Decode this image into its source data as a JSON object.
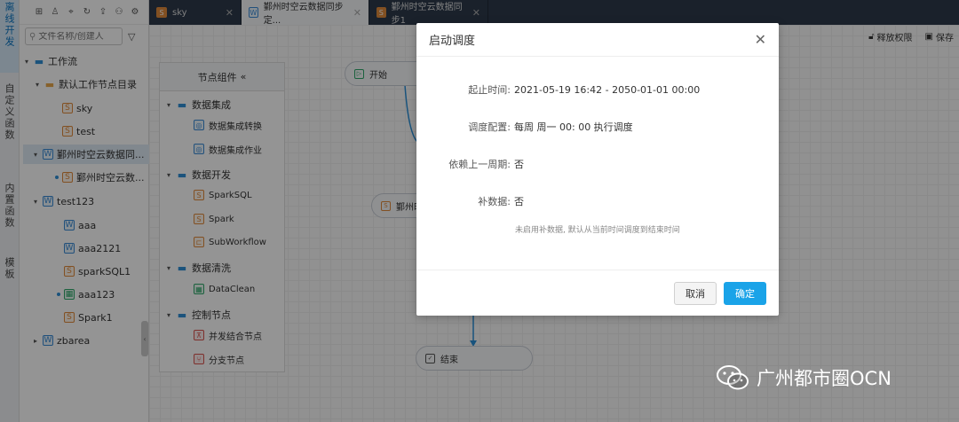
{
  "left_nav": {
    "items": [
      {
        "label": "离线开发",
        "active": true
      },
      {
        "label": "自定义函数",
        "active": false
      },
      {
        "label": "内置函数",
        "active": false
      },
      {
        "label": "模板",
        "active": false
      }
    ]
  },
  "tree": {
    "search_placeholder": "文件名称/创建人",
    "nodes": [
      {
        "label": "工作流",
        "caret": "▾",
        "icon": "folder"
      },
      {
        "label": "默认工作节点目录",
        "caret": "▾",
        "icon": "folder-y"
      },
      {
        "label": "sky",
        "icon": "sql"
      },
      {
        "label": "test",
        "icon": "sql"
      },
      {
        "label": "鄞州时空云数据同...",
        "caret": "▾",
        "icon": "wf"
      },
      {
        "label": "鄞州时空云数...",
        "icon": "sql",
        "dot": true
      },
      {
        "label": "test123",
        "caret": "▾",
        "icon": "wf"
      },
      {
        "label": "aaa",
        "icon": "wf"
      },
      {
        "label": "aaa2121",
        "icon": "wf"
      },
      {
        "label": "sparkSQL1",
        "icon": "sql"
      },
      {
        "label": "aaa123",
        "icon": "gr",
        "dot": true
      },
      {
        "label": "Spark1",
        "icon": "sql"
      },
      {
        "label": "zbarea",
        "caret": "▸",
        "icon": "wf"
      }
    ]
  },
  "tabs": [
    {
      "label": "sky",
      "icon": "orange",
      "active": false
    },
    {
      "label": "鄞州时空云数据同步定...",
      "icon": "blue",
      "active": true
    },
    {
      "label": "鄞州时空云数据同步1",
      "icon": "orange",
      "active": false
    }
  ],
  "toolbar": {
    "release_label": "释放权限",
    "save_label": "保存"
  },
  "palette": {
    "title": "节点组件",
    "groups": [
      {
        "label": "数据集成",
        "items": [
          "数据集成转换",
          "数据集成作业"
        ]
      },
      {
        "label": "数据开发",
        "items": [
          "SparkSQL",
          "Spark",
          "SubWorkflow"
        ]
      },
      {
        "label": "数据清洗",
        "items": [
          "DataClean"
        ]
      },
      {
        "label": "控制节点",
        "items": [
          "并发结合节点",
          "分支节点"
        ]
      }
    ]
  },
  "flow": {
    "start_label": "开始",
    "middle_label": "鄞州时",
    "end_label": "结束"
  },
  "modal": {
    "title": "启动调度",
    "rows": [
      {
        "label": "起止时间:",
        "value": "2021-05-19 16:42 - 2050-01-01 00:00"
      },
      {
        "label": "调度配置:",
        "value": "每周 周一 00: 00 执行调度"
      },
      {
        "label": "依赖上一周期:",
        "value": "否"
      },
      {
        "label": "补数据:",
        "value": "否"
      }
    ],
    "hint": "未启用补数据, 默认从当前时间调度到结束时间",
    "cancel_label": "取消",
    "ok_label": "确定"
  },
  "watermark": {
    "text": "广州都市圈OCN"
  }
}
